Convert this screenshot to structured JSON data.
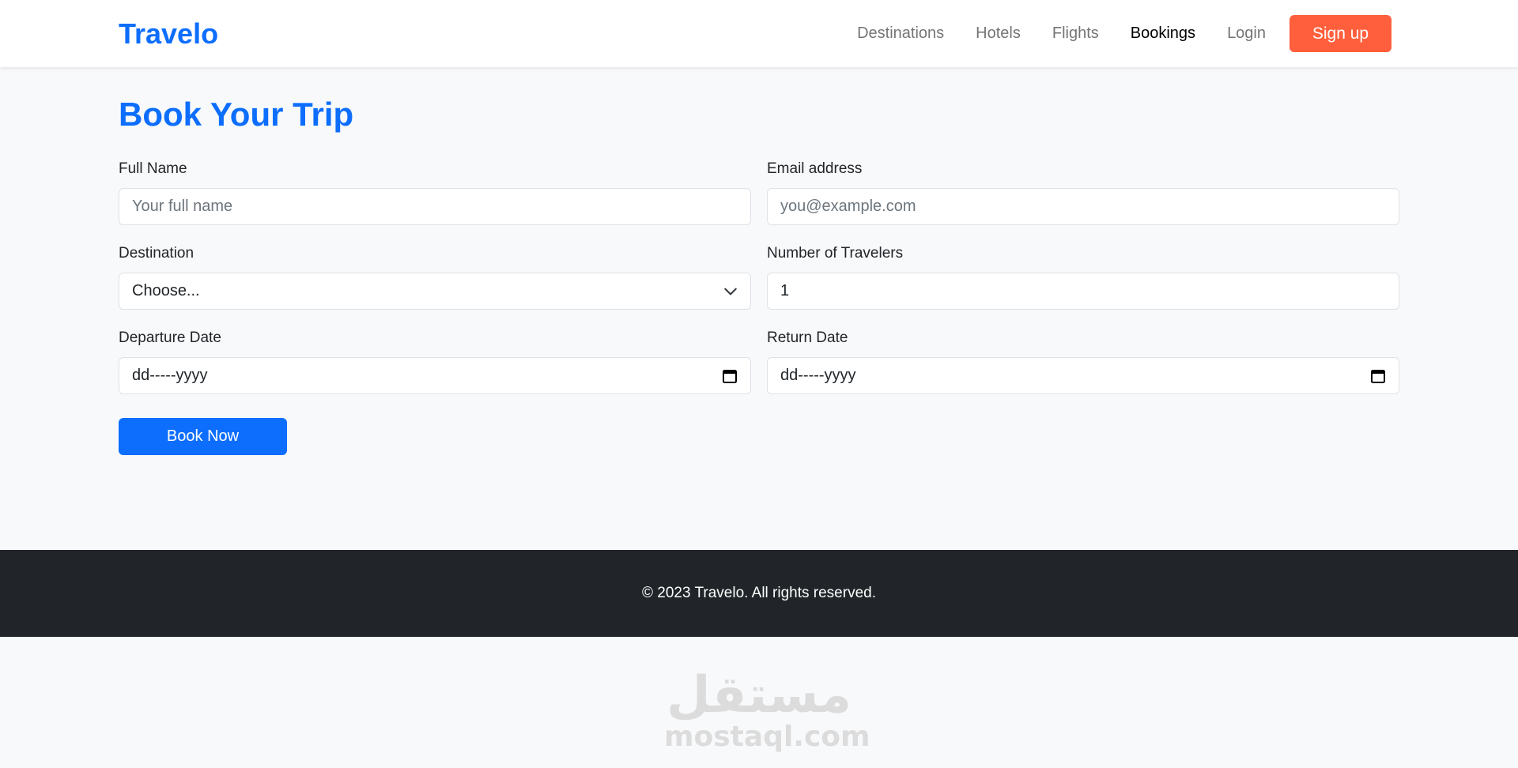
{
  "navbar": {
    "brand": "Travelo",
    "links": [
      {
        "label": "Destinations"
      },
      {
        "label": "Hotels"
      },
      {
        "label": "Flights"
      },
      {
        "label": "Bookings"
      },
      {
        "label": "Login"
      }
    ],
    "active": "Bookings",
    "signup_label": "Sign up",
    "signup_color": "#ff5f3c"
  },
  "form": {
    "title": "Book Your Trip",
    "full_name": {
      "label": "Full Name",
      "placeholder": "Your full name",
      "value": ""
    },
    "email": {
      "label": "Email address",
      "placeholder": "you@example.com",
      "value": ""
    },
    "destination": {
      "label": "Destination",
      "selected": "Choose..."
    },
    "travelers": {
      "label": "Number of Travelers",
      "value": "1"
    },
    "departure": {
      "label": "Departure Date",
      "value": "dd-----yyyy"
    },
    "return": {
      "label": "Return Date",
      "value": "dd-----yyyy"
    },
    "submit_label": "Book Now"
  },
  "footer": {
    "text": "© 2023 Travelo. All rights reserved."
  },
  "watermark": {
    "arabic": "مستقل",
    "latin": "mostaql.com"
  },
  "colors": {
    "primary": "#0d6efd",
    "accent": "#ff5f3c",
    "footer_bg": "#212529",
    "page_bg": "#f8f9fa"
  },
  "icons": {
    "destination_select": "chevron-down-icon",
    "date_fields": "calendar-icon"
  }
}
